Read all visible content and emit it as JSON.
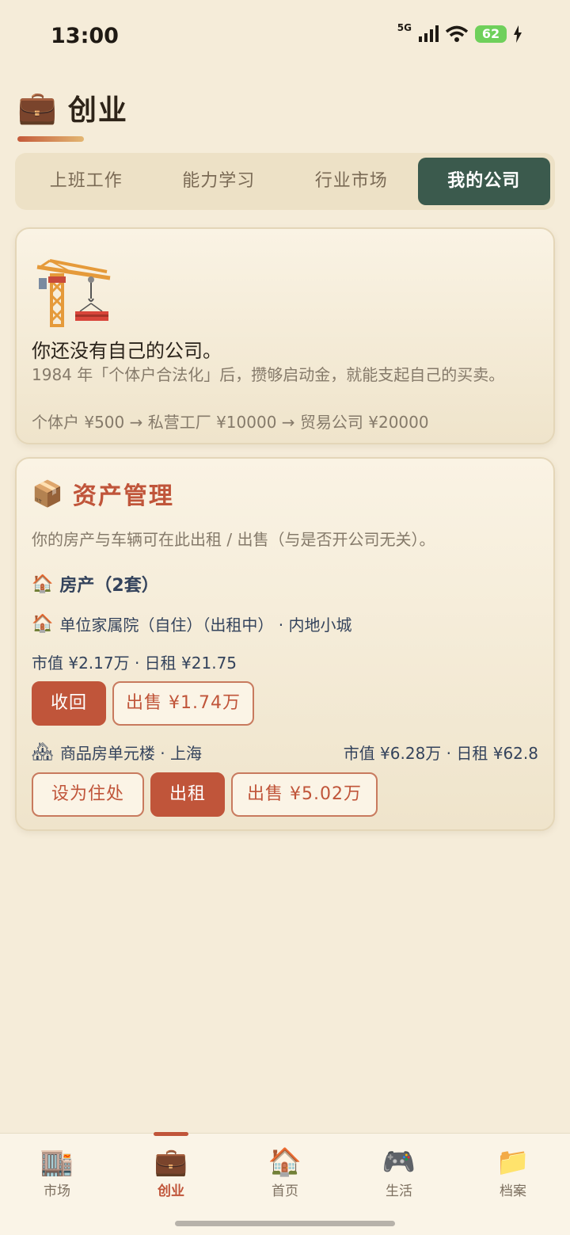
{
  "status": {
    "time": "13:00",
    "network": "5G",
    "battery": "62"
  },
  "header": {
    "icon": "briefcase-icon",
    "emoji": "💼",
    "title": "创业"
  },
  "tabs": [
    {
      "label": "上班工作",
      "active": false
    },
    {
      "label": "能力学习",
      "active": false
    },
    {
      "label": "行业市场",
      "active": false
    },
    {
      "label": "我的公司",
      "active": true
    }
  ],
  "company": {
    "icon": "crane-icon",
    "title": "你还没有自己的公司。",
    "desc": "1984 年「个体户合法化」后，攒够启动金，就能支起自己的买卖。",
    "path": "个体户 ¥500 → 私营工厂 ¥10000 → 贸易公司 ¥20000"
  },
  "assets": {
    "icon_emoji": "📦",
    "title": "资产管理",
    "note": "你的房产与车辆可在此出租 / 出售（与是否开公司无关）。",
    "property_section": {
      "icon_emoji": "🏠",
      "label": "房产（2套）"
    },
    "properties": [
      {
        "icon_emoji": "🏠",
        "name": "单位家属院（自住）（出租中） · 内地小城",
        "value": "市值 ¥2.17万 · 日租 ¥21.75",
        "buttons": [
          "收回",
          "出售 ¥1.74万"
        ]
      },
      {
        "icon_emoji": "🏘",
        "name": "商品房单元楼 · 上海",
        "value": "市值 ¥6.28万 · 日租 ¥62.8",
        "buttons": [
          "设为住处",
          "出租",
          "出售 ¥5.02万"
        ]
      }
    ]
  },
  "nav": [
    {
      "emoji": "🏬",
      "icon": "market-icon",
      "label": "市场",
      "active": false
    },
    {
      "emoji": "💼",
      "icon": "briefcase-icon",
      "label": "创业",
      "active": true
    },
    {
      "emoji": "🏠",
      "icon": "home-icon",
      "label": "首页",
      "active": false
    },
    {
      "emoji": "🎮",
      "icon": "gamepad-icon",
      "label": "生活",
      "active": false
    },
    {
      "emoji": "📁",
      "icon": "folder-icon",
      "label": "档案",
      "active": false
    }
  ],
  "colors": {
    "accent": "#c0553a",
    "tab_active": "#3b5a4d",
    "background": "#f5ecd9",
    "text_blue": "#34435c"
  }
}
